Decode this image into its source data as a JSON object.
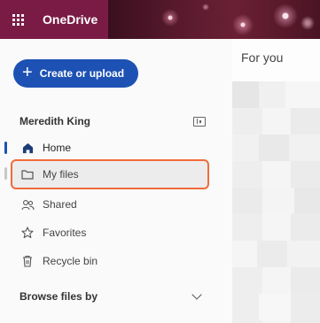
{
  "header": {
    "app_name": "OneDrive"
  },
  "sidebar": {
    "create_label": "Create or upload",
    "user_name": "Meredith King",
    "items": [
      {
        "label": "Home",
        "icon": "home-icon",
        "active": true
      },
      {
        "label": "My files",
        "icon": "folder-icon",
        "selected": true
      },
      {
        "label": "Shared",
        "icon": "people-icon"
      },
      {
        "label": "Favorites",
        "icon": "star-icon"
      },
      {
        "label": "Recycle bin",
        "icon": "trash-icon"
      }
    ],
    "section_title": "Browse files by"
  },
  "main": {
    "title": "For you"
  },
  "colors": {
    "brand": "#7a1b46",
    "accent": "#1d52b4",
    "highlight": "#f26b3a"
  }
}
